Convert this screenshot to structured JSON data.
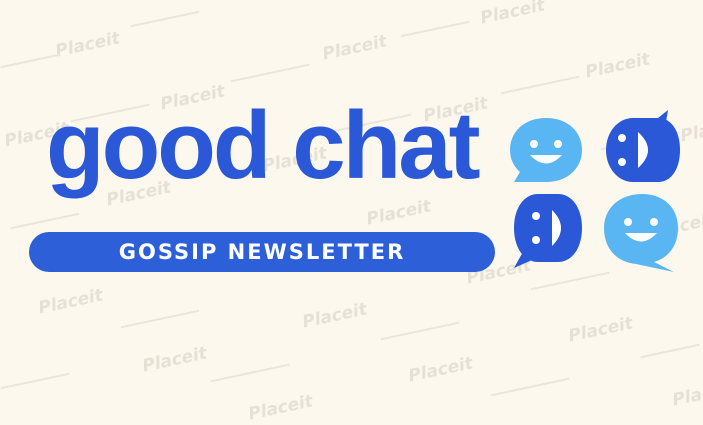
{
  "logo": {
    "title": "good chat",
    "subtitle": "GOSSIP NEWSLETTER",
    "icon": "four-chat-bubble-faces-icon"
  },
  "watermark": {
    "text": "Placeit"
  },
  "colors": {
    "background": "#fcf8ee",
    "brand_blue": "#2a58d6",
    "light_blue": "#5ab6f2",
    "watermark": "#e7e1d5"
  }
}
